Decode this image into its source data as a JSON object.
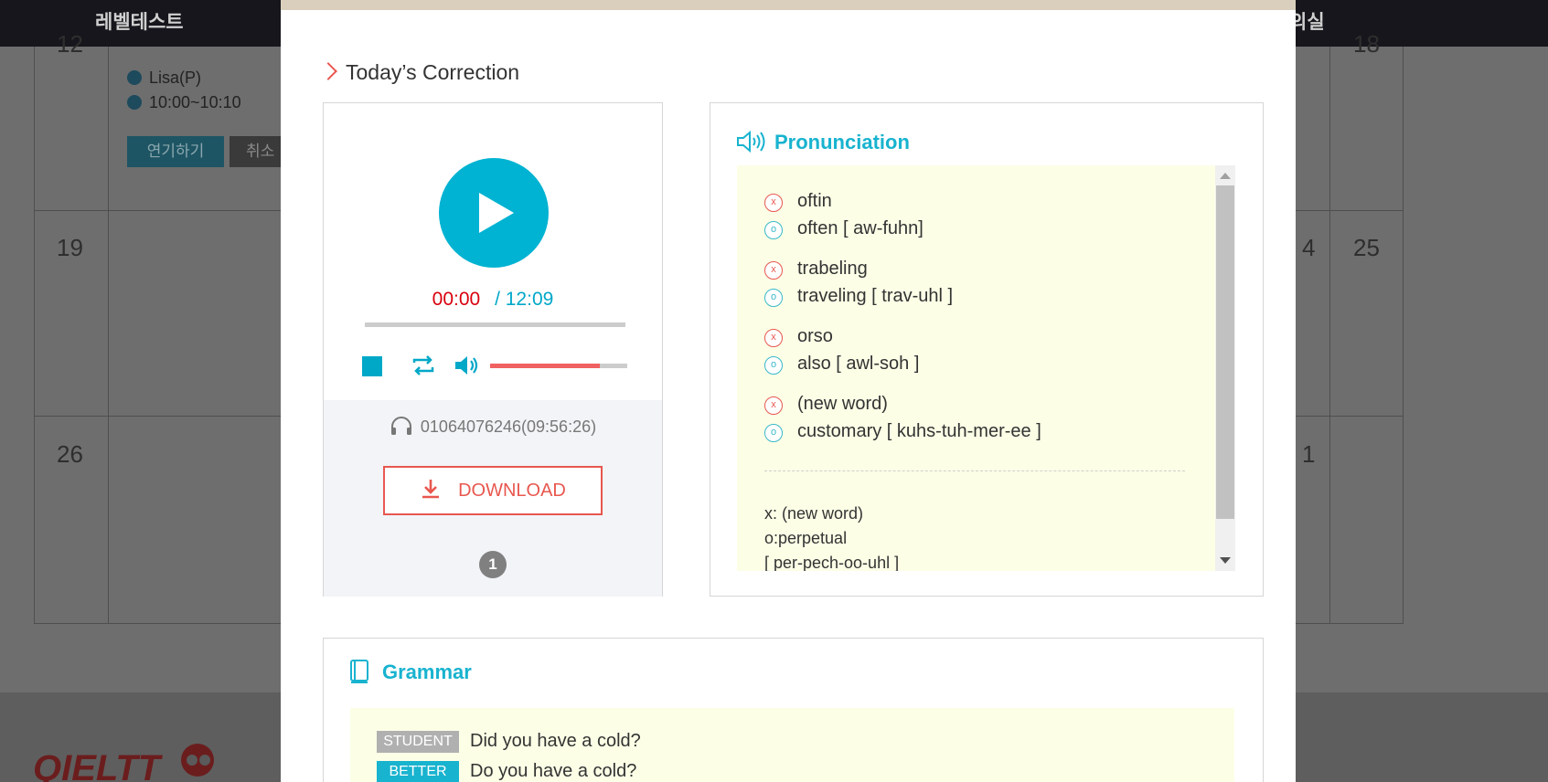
{
  "background": {
    "nav_left": "레벨테스트",
    "nav_right": "의실",
    "day_partial_top_left": "12",
    "day_partial_top_right": "18",
    "day_19": "19",
    "day_25": "25",
    "day_partial_24": "4",
    "day_26": "26",
    "day_partial_31": "1",
    "lesson_teacher": "Lisa(P)",
    "lesson_time": "10:00~10:10",
    "postpone_button": "연기하기",
    "cancel_button": "취소"
  },
  "modal": {
    "section_title": "Today’s Correction",
    "player": {
      "current_time": "00:00",
      "total_time": "/ 12:09",
      "progress_fraction": 0.0,
      "volume_fraction": 0.8,
      "caller": "01064076246(09:56:26)",
      "download_label": "DOWNLOAD",
      "page_number": "1"
    },
    "pronunciation": {
      "title": "Pronunciation",
      "items": [
        {
          "wrong": "oftin",
          "correct": "often [ aw-fuhn]"
        },
        {
          "wrong": "trabeling",
          "correct": "traveling [ trav-uhl ]"
        },
        {
          "wrong": "orso",
          "correct": "also [ awl-soh ]"
        },
        {
          "wrong": "(new word)",
          "correct": "customary [ kuhs-tuh-mer-ee ]"
        }
      ],
      "mark_x": "x",
      "mark_o": "o",
      "notes": {
        "line1": "x: (new word)",
        "line2": "o:perpetual",
        "line3": "[ per-pech-oo-uhl ]"
      }
    },
    "grammar": {
      "title": "Grammar",
      "rows": [
        {
          "tag": "STUDENT",
          "text": "Did you have a cold?"
        },
        {
          "tag": "BETTER",
          "text": "Do you have a cold?"
        }
      ]
    }
  },
  "colors": {
    "accent_cyan": "#00b3d2",
    "accent_red": "#e8574f",
    "time_red": "#d9000d",
    "panel_yellow": "#fcffe6"
  }
}
